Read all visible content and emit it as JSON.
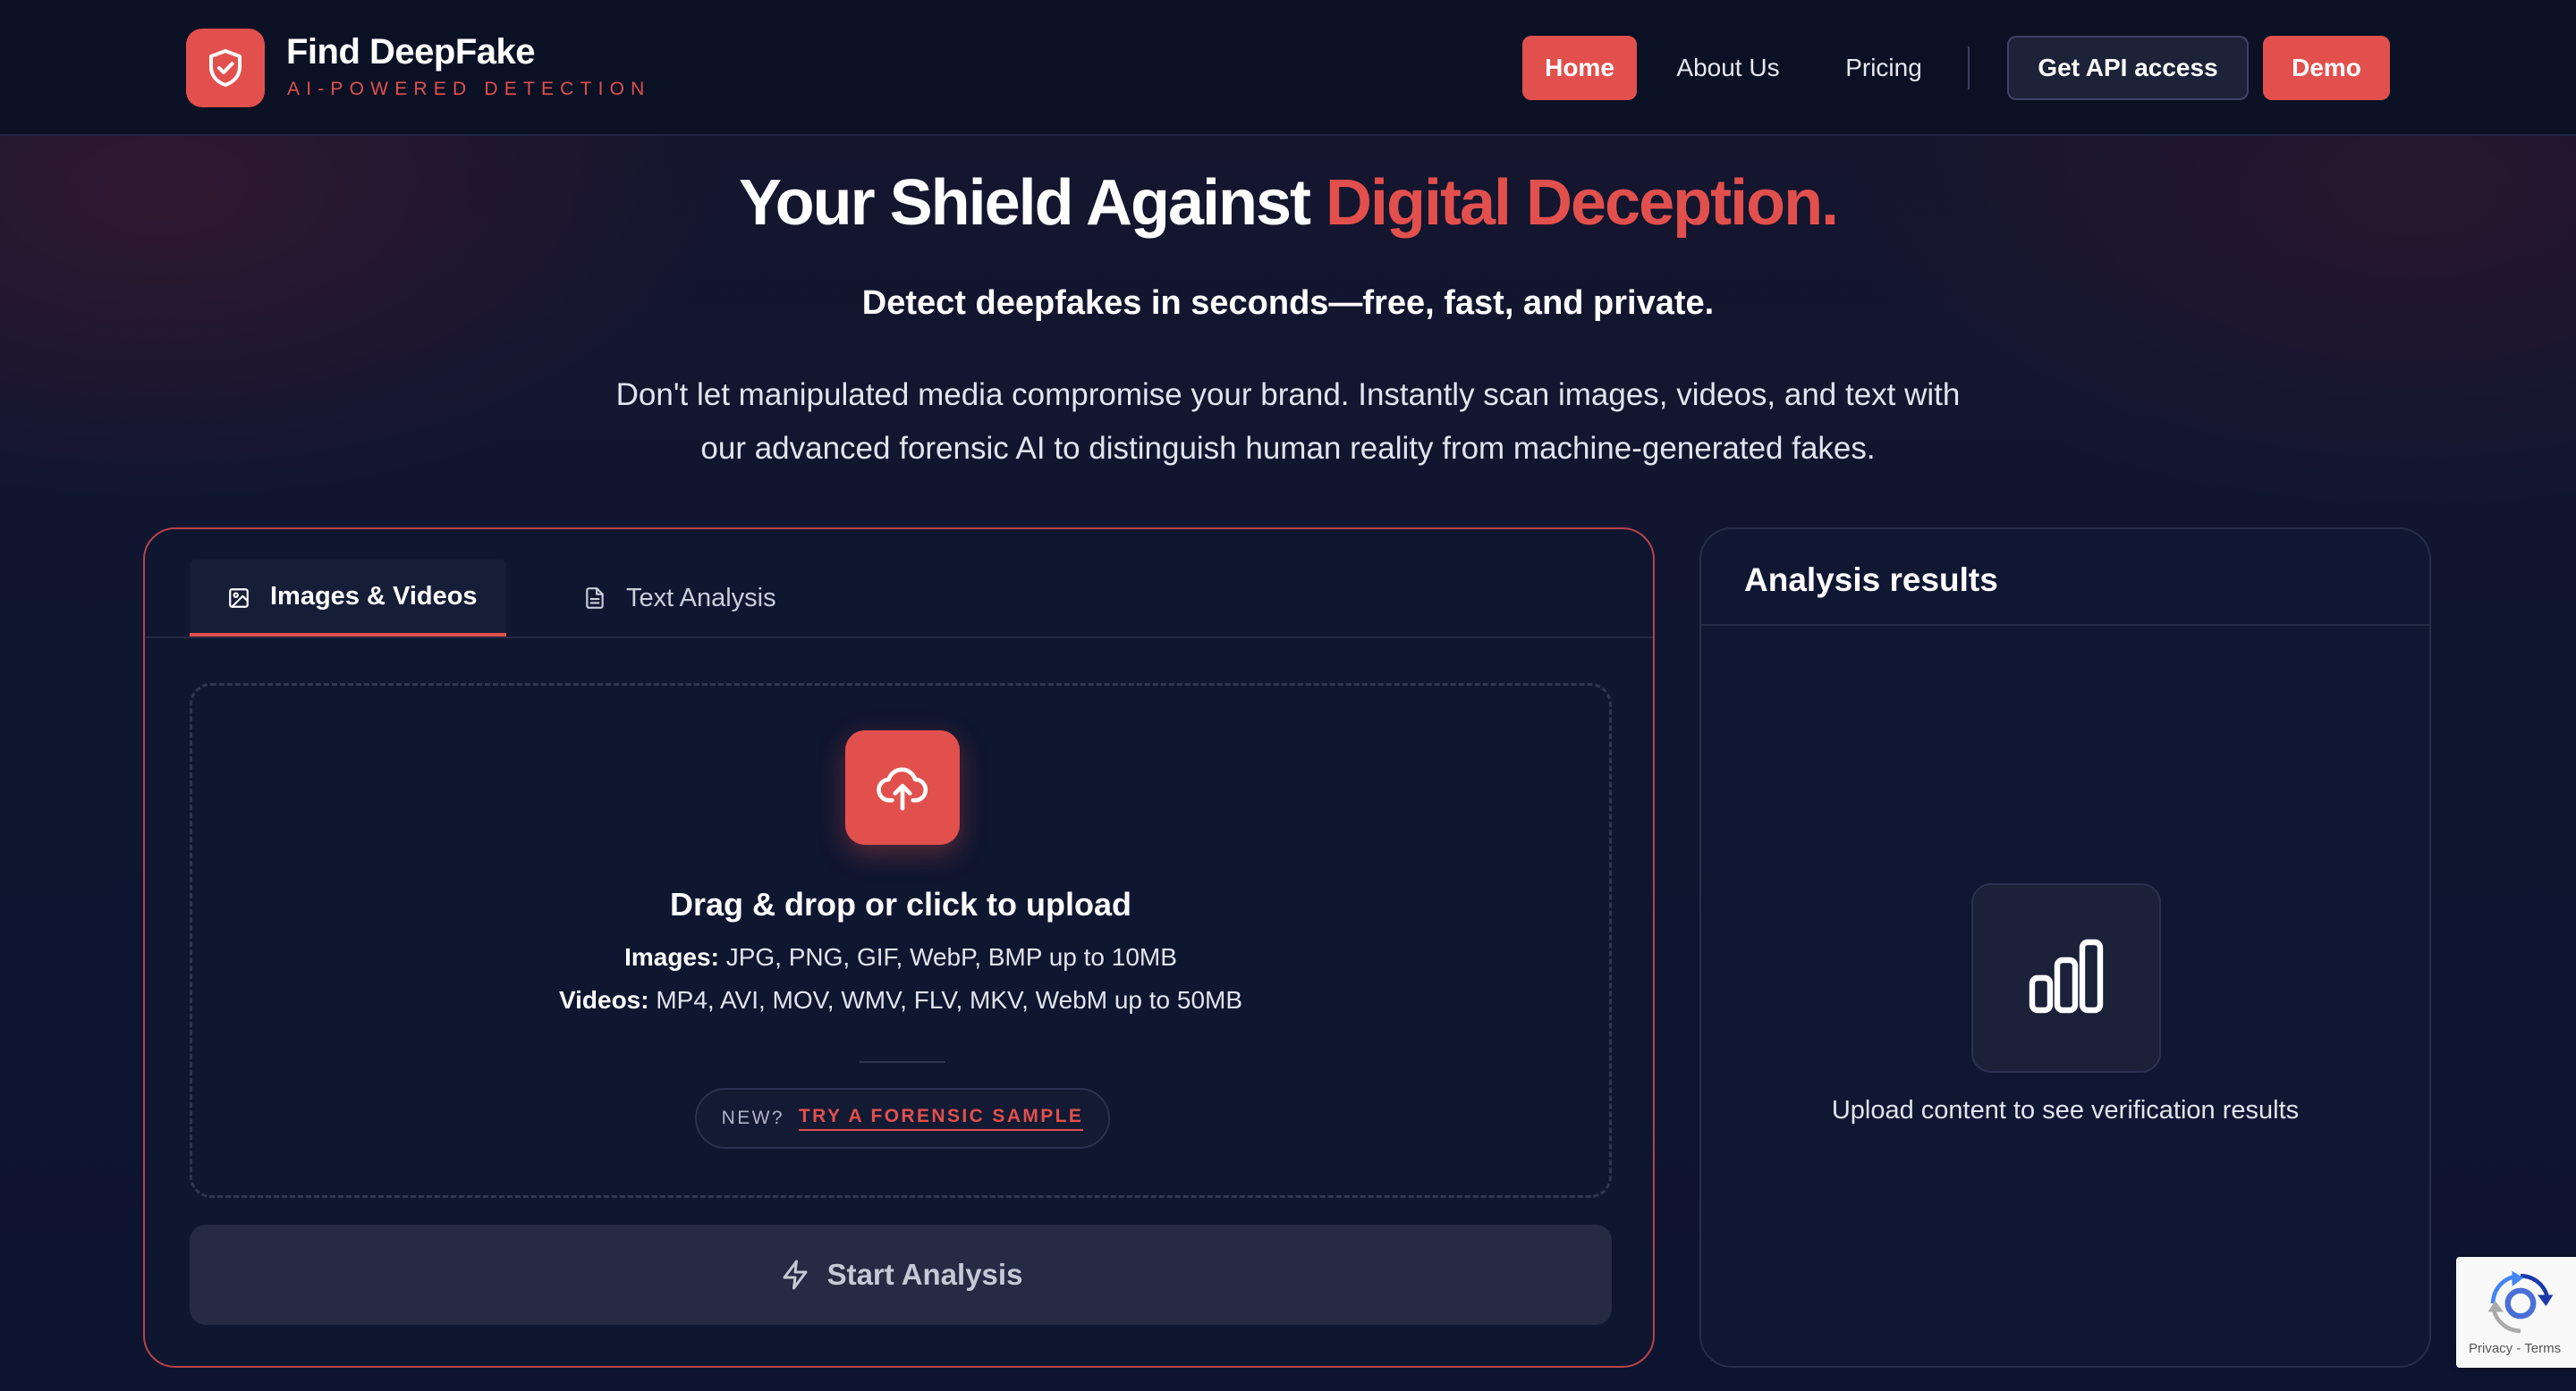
{
  "brand": {
    "name": "Find DeepFake",
    "tagline": "AI-POWERED DETECTION",
    "accent_color": "#e2504d",
    "logo_icon": "shield-check-icon"
  },
  "nav": {
    "home": "Home",
    "about": "About Us",
    "pricing": "Pricing",
    "api": "Get API access",
    "demo": "Demo",
    "active": "Home"
  },
  "hero": {
    "title_main": "Your Shield Against ",
    "title_accent": "Digital Deception.",
    "subtitle": "Detect deepfakes in seconds—free, fast, and private.",
    "description": "Don't let manipulated media compromise your brand. Instantly scan images, videos, and text with our advanced forensic AI to distinguish human reality from machine-generated fakes."
  },
  "upload": {
    "tabs": [
      {
        "label": "Images & Videos",
        "icon": "image-icon",
        "active": true
      },
      {
        "label": "Text Analysis",
        "icon": "document-icon",
        "active": false
      }
    ],
    "dropzone": {
      "icon": "cloud-upload-icon",
      "title": "Drag & drop or click to upload",
      "images_label": "Images:",
      "images_formats": " JPG, PNG, GIF, WebP, BMP up to 10MB",
      "videos_label": "Videos:",
      "videos_formats": " MP4, AVI, MOV, WMV, FLV, MKV, WebM up to 50MB"
    },
    "sample": {
      "new_label": "NEW?",
      "link_label": "TRY A FORENSIC SAMPLE"
    },
    "start_button": "Start Analysis",
    "start_icon": "lightning-icon"
  },
  "results": {
    "title": "Analysis results",
    "icon": "bar-chart-icon",
    "empty_message": "Upload content to see verification results"
  },
  "recaptcha": {
    "terms": "Privacy - Terms"
  }
}
